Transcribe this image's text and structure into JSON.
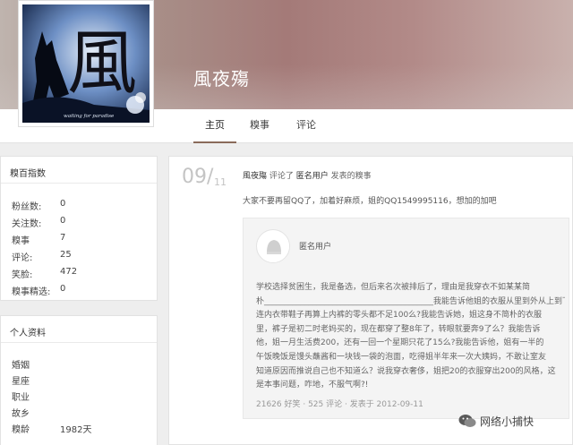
{
  "profile": {
    "username": "風夜殤",
    "avatar_logo_text": "風",
    "avatar_caption": "waiting for paradise"
  },
  "tabs": [
    {
      "label": "主页",
      "active": true
    },
    {
      "label": "糗事",
      "active": false
    },
    {
      "label": "评论",
      "active": false
    }
  ],
  "stats": {
    "title": "糗百指数",
    "rows": [
      {
        "key": "粉丝数:",
        "value": "0"
      },
      {
        "key": "关注数:",
        "value": "0"
      },
      {
        "key": "糗事",
        "value": "7"
      },
      {
        "key": "评论:",
        "value": "25"
      },
      {
        "key": "笑脸:",
        "value": "472"
      },
      {
        "key": "糗事精选:",
        "value": "0"
      }
    ]
  },
  "personal": {
    "title": "个人资料",
    "rows": [
      {
        "key": "婚姻",
        "value": ""
      },
      {
        "key": "星座",
        "value": ""
      },
      {
        "key": "职业",
        "value": ""
      },
      {
        "key": "故乡",
        "value": ""
      },
      {
        "key": "糗龄",
        "value": "1982天"
      }
    ]
  },
  "feed": {
    "date_day": "09/",
    "date_month": "11",
    "actor": "風夜殤",
    "verb": "评论了",
    "target_user": "匿名用户",
    "suffix": "发表的糗事",
    "comment": "大家不要再留QQ了，加着好麻烦，姐的QQ1549995116，想加的加吧",
    "quote": {
      "user": "匿名用户",
      "lines": [
        "学校选择贫困生，我是备选，但后来名次被排后了，理由是我穿衣不如某某简",
        "朴__________________________________________我能告诉他姐的衣服从里到外从上到下",
        "连内衣带鞋子再算上内裤的零头都不足100么?我能告诉她，姐这身不简朴的衣服",
        "里，裤子是初二时老妈买的，现在都穿了整8年了，转眼就要奔9了么？我能告诉",
        "他，姐一月生活费200，还有一回一个星期只花了15么?我能告诉他，姐有一半的",
        "午饭晚饭是馒头蘸酱和一块钱一袋的泡面，吃得姐半年来一次大姨妈，不敢让室友",
        "知道原因而推说自己也不知道么？说我穿衣奢侈，姐把20的衣服穿出200的风格，这",
        "是本事问题，咋地，不服气啊?!"
      ],
      "meta": "21626 好笑 · 525 评论 · 发表于 2012-09-11"
    }
  },
  "watermark": {
    "icon": "wechat-icon",
    "text": "网络小捕快"
  }
}
